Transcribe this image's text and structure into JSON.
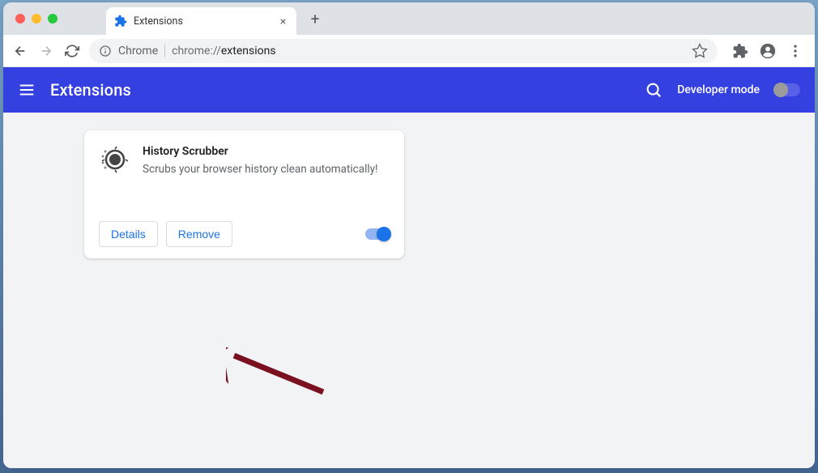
{
  "tab": {
    "title": "Extensions"
  },
  "addressbar": {
    "origin": "Chrome",
    "path_prefix": "chrome://",
    "path_bold": "extensions"
  },
  "toolbar": {
    "title": "Extensions",
    "dev_mode_label": "Developer mode",
    "dev_mode_on": false
  },
  "extension": {
    "name": "History Scrubber",
    "description": "Scrubs your browser history clean automatically!",
    "details_label": "Details",
    "remove_label": "Remove",
    "enabled": true
  }
}
